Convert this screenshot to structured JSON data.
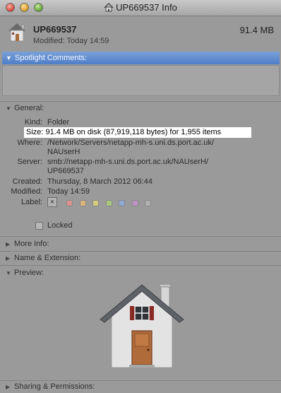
{
  "window": {
    "title": "UP669537 Info"
  },
  "header": {
    "name": "UP669537",
    "modified": "Modified: Today 14:59",
    "size": "91.4 MB"
  },
  "spotlight": {
    "label": "Spotlight Comments:"
  },
  "general": {
    "label": "General:",
    "kind_label": "Kind:",
    "kind_value": "Folder",
    "size_text": "Size: 91.4 MB on disk (87,919,118 bytes) for 1,955 items",
    "where_label": "Where:",
    "where_value_1": "/Network/Servers/netapp-mh-s.uni.ds.port.ac.uk/",
    "where_value_2": "NAUserH",
    "server_label": "Server:",
    "server_value_1": "smb://netapp-mh-s.uni.ds.port.ac.uk/NAUserH/",
    "server_value_2": "UP669537",
    "created_label": "Created:",
    "created_value": "Thursday, 8 March 2012 06:44",
    "modified_label": "Modified:",
    "modified_value": "Today 14:59",
    "label_label": "Label:",
    "label_none": "×",
    "label_colors": [
      "#d9928f",
      "#d9b47c",
      "#d4cc7a",
      "#a9c87d",
      "#8fa8d4",
      "#bc94c4",
      "#b0b0b0"
    ],
    "locked_label": "Locked"
  },
  "sections": {
    "more_info": "More Info:",
    "name_ext": "Name & Extension:",
    "preview": "Preview:",
    "sharing": "Sharing & Permissions:"
  }
}
